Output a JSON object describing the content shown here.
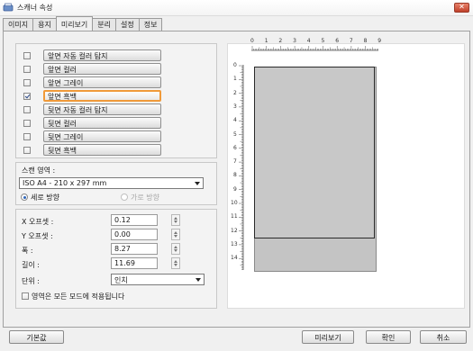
{
  "window": {
    "title": "스캐너 속성",
    "close_glyph": "✕"
  },
  "tabs": [
    {
      "label": "이미지",
      "active": false
    },
    {
      "label": "용지",
      "active": false
    },
    {
      "label": "미리보기",
      "active": true
    },
    {
      "label": "분리",
      "active": false
    },
    {
      "label": "설정",
      "active": false
    },
    {
      "label": "정보",
      "active": false
    }
  ],
  "image_modes": [
    {
      "label": "앞면 자동 컬러 탐지",
      "checked": false
    },
    {
      "label": "앞면 컬러",
      "checked": false
    },
    {
      "label": "앞면 그레이",
      "checked": false
    },
    {
      "label": "앞면 흑백",
      "checked": true,
      "selected": true
    },
    {
      "label": "뒷면 자동 컬러 탐지",
      "checked": false
    },
    {
      "label": "뒷면 컬러",
      "checked": false
    },
    {
      "label": "뒷면 그레이",
      "checked": false
    },
    {
      "label": "뒷면 흑백",
      "checked": false
    }
  ],
  "scan_area": {
    "label": "스캔 영역 :",
    "value": "ISO A4 - 210 x 297 mm",
    "orientation_portrait": "세로 방향",
    "orientation_landscape": "가로 방향"
  },
  "offsets": {
    "x_label": "X 오프셋 :",
    "x_value": "0.12",
    "y_label": "Y 오프셋 :",
    "y_value": "0.00",
    "width_label": "폭 :",
    "width_value": "8.27",
    "length_label": "길이 :",
    "length_value": "11.69",
    "unit_label": "단위 :",
    "unit_value": "인치",
    "apply_all_label": "영역은 모든 모드에 적용됩니다"
  },
  "ruler": {
    "top": [
      "0",
      "1",
      "2",
      "3",
      "4",
      "5",
      "6",
      "7",
      "8",
      "9"
    ],
    "left": [
      "0",
      "1",
      "2",
      "3",
      "4",
      "5",
      "6",
      "7",
      "8",
      "9",
      "10",
      "11",
      "12",
      "13",
      "14"
    ]
  },
  "buttons": {
    "default": "기본값",
    "preview": "미리보기",
    "ok": "확인",
    "cancel": "취소"
  },
  "colors": {
    "accent": "#f09a3a",
    "window_bg": "#f0f0f0",
    "paper": "#c4c4c4"
  },
  "icons": [
    "scanner-icon",
    "close-icon",
    "checkbox-icon",
    "dropdown-arrow-icon",
    "spin-arrows-icon"
  ]
}
